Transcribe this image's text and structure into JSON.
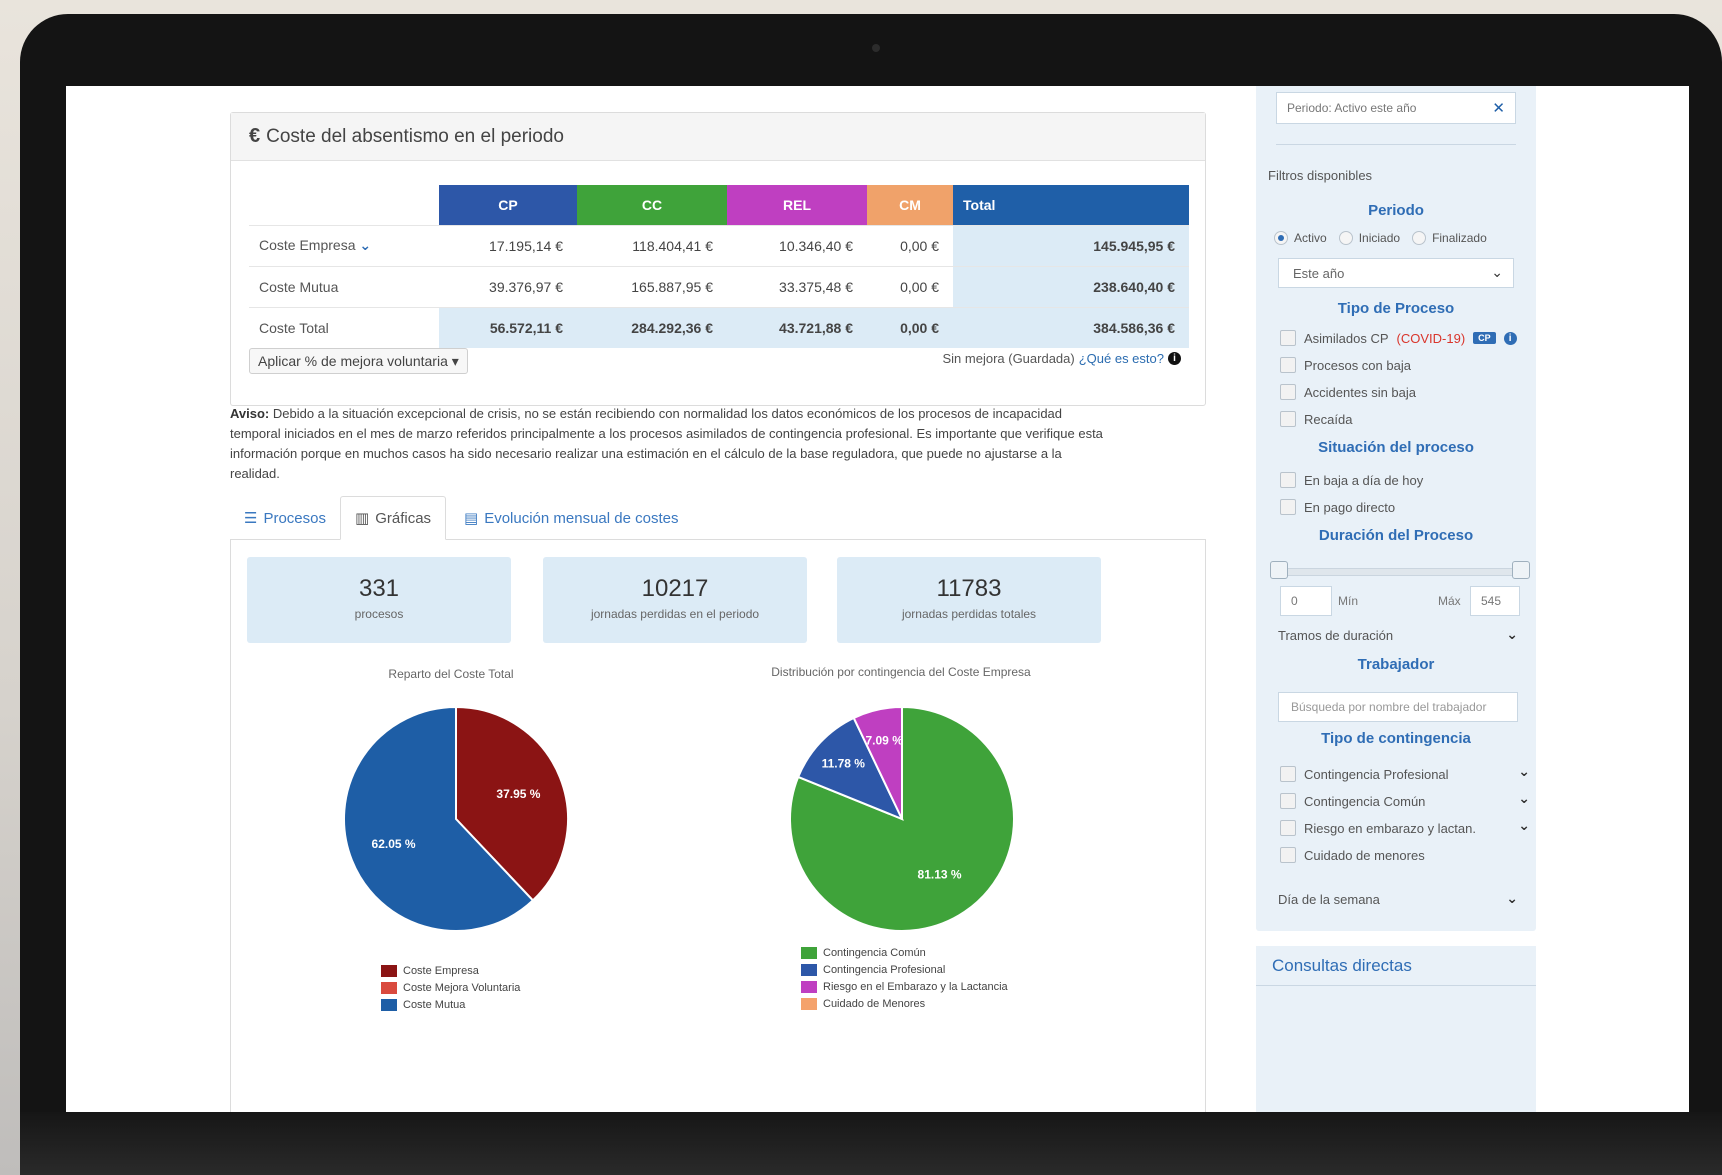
{
  "cost_panel": {
    "title": "Coste del absentismo en el periodo",
    "columns": [
      {
        "label": "CP",
        "color": "#2d57a8"
      },
      {
        "label": "CC",
        "color": "#3fa33a"
      },
      {
        "label": "REL",
        "color": "#bf3fc1"
      },
      {
        "label": "CM",
        "color": "#f0a26a"
      },
      {
        "label": "Total",
        "color": "#1f5fa8"
      }
    ],
    "rows": [
      {
        "label": "Coste Empresa",
        "values": [
          "17.195,14 €",
          "118.404,41 €",
          "10.346,40 €",
          "0,00 €",
          "145.945,95 €"
        ]
      },
      {
        "label": "Coste Mutua",
        "values": [
          "39.376,97 €",
          "165.887,95 €",
          "33.375,48 €",
          "0,00 €",
          "238.640,40 €"
        ]
      },
      {
        "label": "Coste Total",
        "values": [
          "56.572,11 €",
          "284.292,36 €",
          "43.721,88 €",
          "0,00 €",
          "384.586,36 €"
        ]
      }
    ],
    "mejora_button": "Aplicar % de mejora voluntaria",
    "sin_mejora": "Sin mejora (Guardada)",
    "que_es": "¿Qué es esto?"
  },
  "aviso": {
    "label": "Aviso:",
    "text": "Debido a la situación excepcional de crisis, no se están recibiendo con normalidad los datos económicos de los procesos de incapacidad temporal iniciados en el mes de marzo referidos principalmente a los procesos asimilados de contingencia profesional. Es importante que verifique esta información porque en muchos casos ha sido necesario realizar una estimación en el cálculo de la base reguladora, que puede no ajustarse a la realidad."
  },
  "tabs": [
    {
      "label": "Procesos",
      "icon": "list-icon"
    },
    {
      "label": "Gráficas",
      "icon": "bar-chart-icon"
    },
    {
      "label": "Evolución mensual de costes",
      "icon": "table-icon"
    }
  ],
  "stats": [
    {
      "value": "331",
      "label": "procesos"
    },
    {
      "value": "10217",
      "label": "jornadas perdidas en el periodo"
    },
    {
      "value": "11783",
      "label": "jornadas perdidas totales"
    }
  ],
  "chart_data": [
    {
      "type": "pie",
      "title": "Reparto del Coste Total",
      "categories": [
        "Coste Empresa",
        "Coste Mejora Voluntaria",
        "Coste Mutua"
      ],
      "values": [
        37.95,
        0,
        62.05
      ],
      "colors": [
        "#8b1414",
        "#d94a3e",
        "#1e5ea6"
      ],
      "data_labels": [
        "37.95 %",
        "",
        "62.05 %"
      ],
      "legend": "bottom"
    },
    {
      "type": "pie",
      "title": "Distribución por contingencia del Coste Empresa",
      "categories": [
        "Contingencia Común",
        "Contingencia Profesional",
        "Riesgo en el Embarazo y la Lactancia",
        "Cuidado de Menores"
      ],
      "values": [
        81.13,
        11.78,
        7.09,
        0
      ],
      "colors": [
        "#3fa33a",
        "#2d57a8",
        "#bf3fc1",
        "#f4a26c"
      ],
      "data_labels": [
        "81.13 %",
        "11.78 %",
        "7.09 %",
        ""
      ],
      "legend": "bottom"
    }
  ],
  "filters": {
    "period_chip": "Periodo: Activo este año",
    "disponibles": "Filtros disponibles",
    "periodo_title": "Periodo",
    "radio_activo": "Activo",
    "radio_iniciado": "Iniciado",
    "radio_finalizado": "Finalizado",
    "period_select": "Este año",
    "tipo_proceso_title": "Tipo de Proceso",
    "asimilados": "Asimilados CP",
    "covid": "(COVID-19)",
    "cp_badge": "CP",
    "procesos_baja": "Procesos con baja",
    "accidentes": "Accidentes sin baja",
    "recaida": "Recaída",
    "situacion_title": "Situación del proceso",
    "en_baja": "En baja a día de hoy",
    "pago_directo": "En pago directo",
    "duracion_title": "Duración del Proceso",
    "min_value": "0",
    "min_label": "Mín",
    "max_label": "Máx",
    "max_value": "545",
    "tramos": "Tramos de duración",
    "trabajador_title": "Trabajador",
    "trabajador_placeholder": "Búsqueda por nombre del trabajador",
    "contingencia_title": "Tipo de contingencia",
    "cont_profesional": "Contingencia Profesional",
    "cont_comun": "Contingencia Común",
    "riesgo": "Riesgo en embarazo y lactan.",
    "cuidado": "Cuidado de menores",
    "dia_semana": "Día de la semana"
  },
  "consultas": {
    "title": "Consultas directas"
  }
}
